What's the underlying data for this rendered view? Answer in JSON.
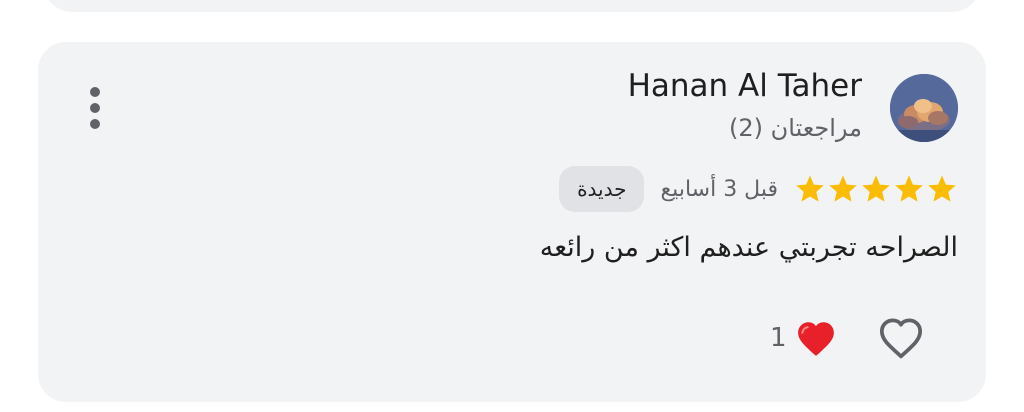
{
  "review": {
    "reviewer_name": "Hanan Al Taher",
    "review_count": "مراجعتان (2)",
    "rating": 5,
    "rating_max": 5,
    "time_ago": "قبل 3 أسابيع",
    "badge": "جديدة",
    "text": "الصراحه تجربتي عندهم اكثر من رائعه",
    "reactions": {
      "count": "1",
      "icon": "red-heart-icon"
    },
    "like_icon": "heart-outline-icon",
    "more_icon": "more-vert-icon"
  },
  "colors": {
    "card_background": "#f2f3f5",
    "star": "#fbbc04",
    "badge_background": "#e0e2e5",
    "heart_red": "#e8202a",
    "icon_gray": "#5f6368"
  }
}
